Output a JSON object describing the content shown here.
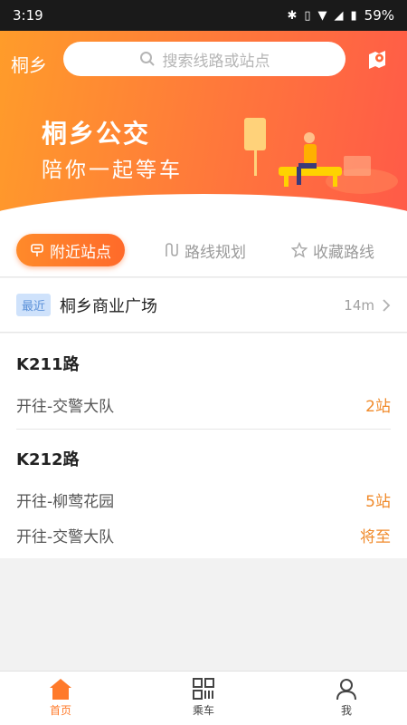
{
  "status": {
    "time": "3:19",
    "battery": "59%"
  },
  "header": {
    "city": "桐乡",
    "search_placeholder": "搜索线路或站点"
  },
  "banner": {
    "title": "桐乡公交",
    "subtitle": "陪你一起等车"
  },
  "tabs": [
    {
      "label": "附近站点",
      "active": true
    },
    {
      "label": "路线规划",
      "active": false
    },
    {
      "label": "收藏路线",
      "active": false
    }
  ],
  "recent": {
    "badge": "最近",
    "station": "桐乡商业广场",
    "distance": "14m"
  },
  "routes": [
    {
      "name": "K211路",
      "directions": [
        {
          "to": "开往-交警大队",
          "stops": "2站"
        }
      ]
    },
    {
      "name": "K212路",
      "directions": [
        {
          "to": "开往-柳莺花园",
          "stops": "5站"
        },
        {
          "to": "开往-交警大队",
          "stops": "将至"
        }
      ]
    }
  ],
  "nav": [
    {
      "label": "首页"
    },
    {
      "label": "乘车"
    },
    {
      "label": "我"
    }
  ],
  "colors": {
    "accent": "#ff7a2a",
    "badge_bg": "#cfe2fb",
    "stops": "#f08a2a"
  }
}
